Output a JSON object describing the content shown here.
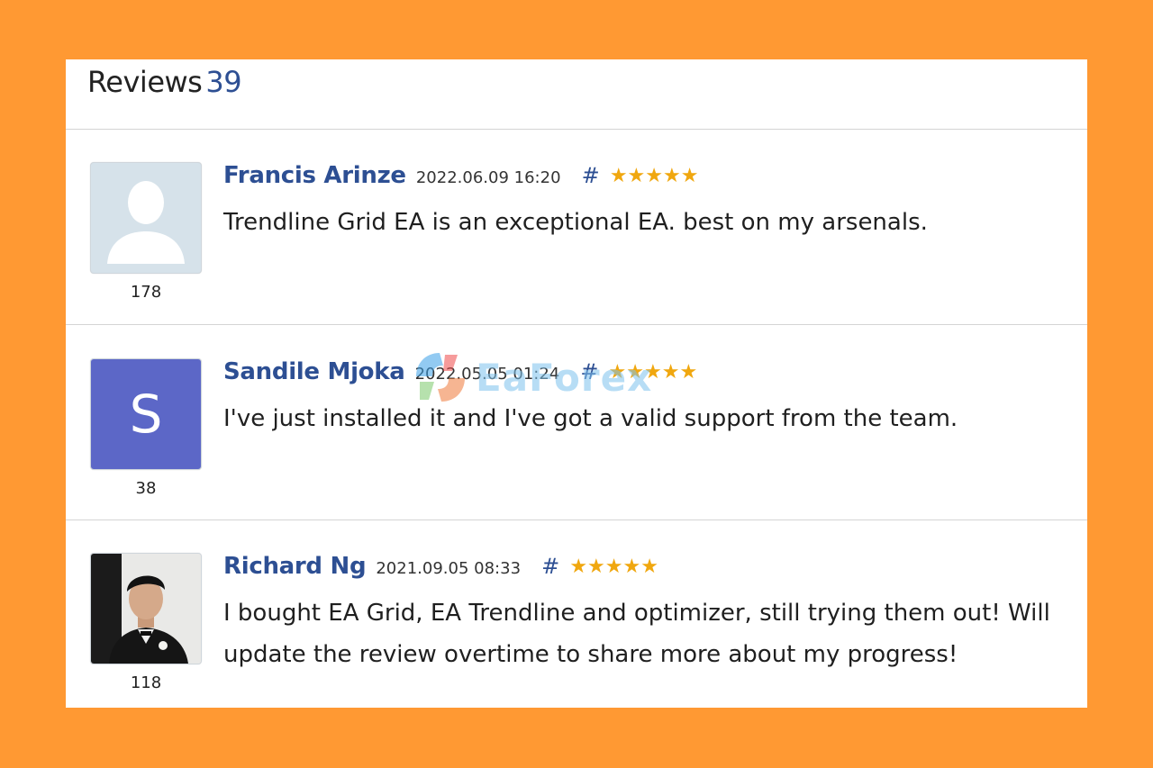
{
  "reviews_header": {
    "title": "Reviews",
    "count": "39"
  },
  "reviews": [
    {
      "author": "Francis Arinze",
      "date": "2022.06.09 16:20",
      "hash": "#",
      "stars": 5,
      "stars_display": "★★★★★",
      "text": "Trendline Grid EA is an exceptional EA. best on my arsenals.",
      "user_rating": "178",
      "avatar": {
        "type": "placeholder",
        "icon": "user-silhouette-icon"
      }
    },
    {
      "author": "Sandile Mjoka",
      "date": "2022.05.05 01:24",
      "hash": "#",
      "stars": 5,
      "stars_display": "★★★★★",
      "text": "I've just installed it and I've got a valid support from the team.",
      "user_rating": "38",
      "avatar": {
        "type": "letter",
        "letter": "S",
        "color": "#5c67c7"
      }
    },
    {
      "author": "Richard Ng",
      "date": "2021.09.05 08:33",
      "hash": "#",
      "stars": 5,
      "stars_display": "★★★★★",
      "text": "I bought EA Grid, EA Trendline and optimizer, still trying them out! Will update the review overtime to share more about my progress!",
      "user_rating": "118",
      "avatar": {
        "type": "photo"
      }
    }
  ],
  "watermark": {
    "text": "EaForex"
  },
  "colors": {
    "background": "#ff9933",
    "link": "#2d4f93",
    "star": "#f0a70f",
    "divider": "#d4d4d4"
  }
}
